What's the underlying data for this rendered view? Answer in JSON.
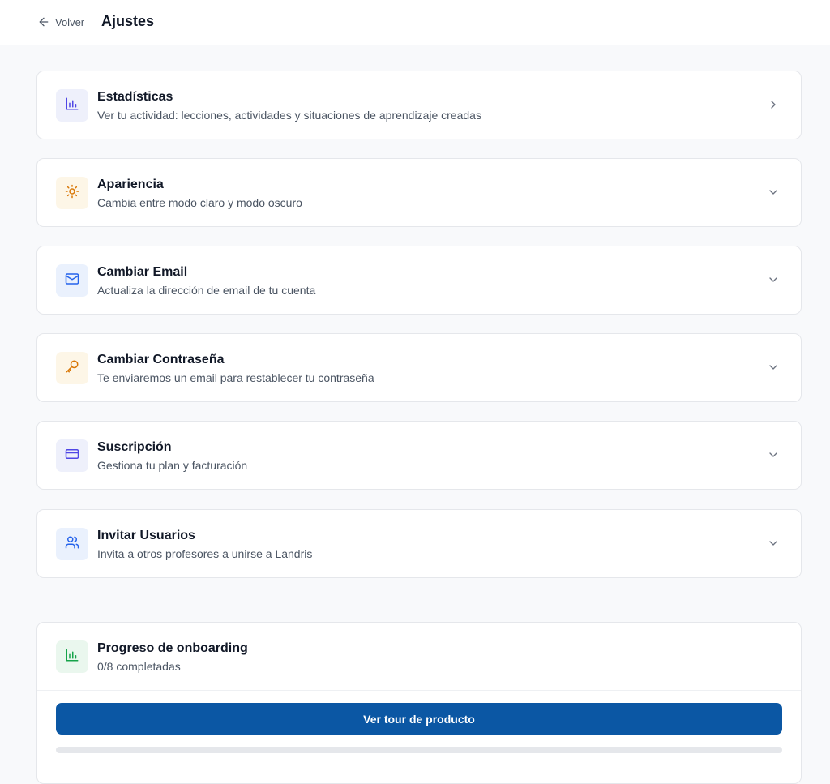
{
  "header": {
    "back_label": "Volver",
    "title": "Ajustes"
  },
  "cards": [
    {
      "title": "Estadísticas",
      "description": "Ver tu actividad: lecciones, actividades y situaciones de aprendizaje creadas",
      "icon": "bar-chart-icon",
      "icon_color": "#4f46e5",
      "icon_bg": "#eef0fb",
      "chevron": "right"
    },
    {
      "title": "Apariencia",
      "description": "Cambia entre modo claro y modo oscuro",
      "icon": "sun-icon",
      "icon_color": "#d97706",
      "icon_bg": "#fdf6e7",
      "chevron": "down"
    },
    {
      "title": "Cambiar Email",
      "description": "Actualiza la dirección de email de tu cuenta",
      "icon": "mail-icon",
      "icon_color": "#2563eb",
      "icon_bg": "#eaf1fd",
      "chevron": "down"
    },
    {
      "title": "Cambiar Contraseña",
      "description": "Te enviaremos un email para restablecer tu contraseña",
      "icon": "key-icon",
      "icon_color": "#d97706",
      "icon_bg": "#fdf6e7",
      "chevron": "down"
    },
    {
      "title": "Suscripción",
      "description": "Gestiona tu plan y facturación",
      "icon": "credit-card-icon",
      "icon_color": "#4f46e5",
      "icon_bg": "#eef0fb",
      "chevron": "down"
    },
    {
      "title": "Invitar Usuarios",
      "description": "Invita a otros profesores a unirse a Landris",
      "icon": "users-icon",
      "icon_color": "#2563eb",
      "icon_bg": "#eaf1fd",
      "chevron": "down"
    }
  ],
  "onboarding": {
    "title": "Progreso de onboarding",
    "status": "0/8 completadas",
    "completed": 0,
    "total": 8,
    "icon": "bar-chart-icon",
    "icon_color": "#16a34a",
    "icon_bg": "#eaf7ee",
    "button_label": "Ver tour de producto",
    "button_color": "#0b57a4"
  }
}
